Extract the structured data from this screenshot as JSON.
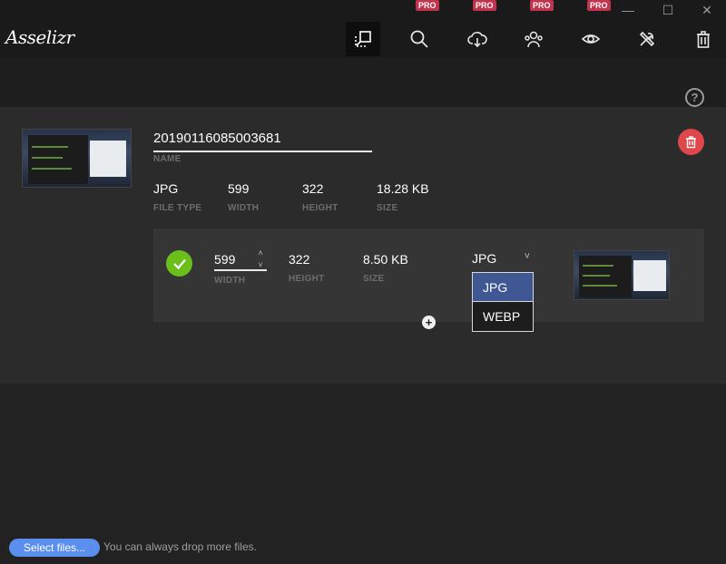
{
  "app": {
    "logo_text": "Asselizr"
  },
  "window_controls": {
    "minimize": "—",
    "maximize": "☐",
    "close": "✕"
  },
  "toolbar": {
    "pro_badge": "PRO",
    "tools": [
      {
        "icon": "resize-icon",
        "active": true,
        "pro": false
      },
      {
        "icon": "search-icon",
        "active": false,
        "pro": true
      },
      {
        "icon": "cloud-download-icon",
        "active": false,
        "pro": true
      },
      {
        "icon": "users-icon",
        "active": false,
        "pro": true
      },
      {
        "icon": "eye-icon",
        "active": false,
        "pro": true
      },
      {
        "icon": "tools-icon",
        "active": false,
        "pro": false
      },
      {
        "icon": "trash-icon",
        "active": false,
        "pro": false
      }
    ]
  },
  "help": {
    "label": "?"
  },
  "file": {
    "name": "20190116085003681",
    "name_label": "NAME",
    "file_type": "JPG",
    "file_type_label": "FILE TYPE",
    "width": "599",
    "width_label": "WIDTH",
    "height": "322",
    "height_label": "HEIGHT",
    "size": "18.28 KB",
    "size_label": "SIZE"
  },
  "conversion": {
    "width": "599",
    "width_label": "WIDTH",
    "height": "322",
    "height_label": "HEIGHT",
    "size": "8.50 KB",
    "size_label": "SIZE",
    "format": "JPG",
    "format_options": [
      "JPG",
      "WEBP"
    ],
    "selected_option": "JPG"
  },
  "add_label": "+",
  "footer": {
    "select_button": "Select files...",
    "hint": "You can always drop more files."
  },
  "colors": {
    "pro_badge": "#c2334d",
    "delete_button": "#e0474c",
    "success_check": "#6bbf1a",
    "dropdown_selected": "#3f5893",
    "select_button": "#5a8ff0"
  }
}
